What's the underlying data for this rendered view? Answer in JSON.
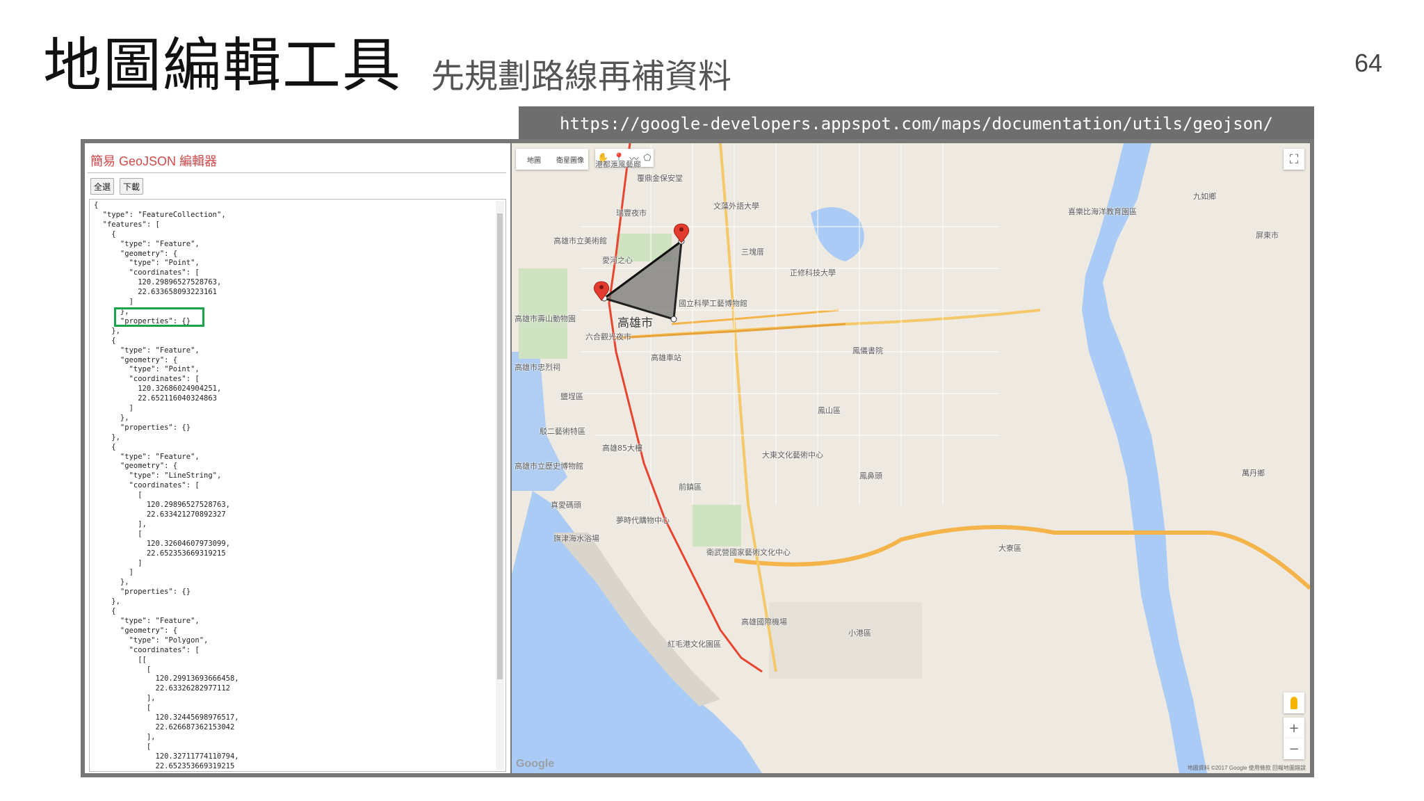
{
  "slide": {
    "title": "地圖編輯工具",
    "subtitle": "先規劃路線再補資料",
    "page_number": "64",
    "url": "https://google-developers.appspot.com/maps/documentation/utils/geojson/"
  },
  "editor": {
    "title": "簡易 GeoJSON 編輯器",
    "buttons": [
      "全選",
      "下載"
    ],
    "code": "{\n  \"type\": \"FeatureCollection\",\n  \"features\": [\n    {\n      \"type\": \"Feature\",\n      \"geometry\": {\n        \"type\": \"Point\",\n        \"coordinates\": [\n          120.29896527528763,\n          22.633658093223161\n        ]\n      },\n      \"properties\": {}\n    },\n    {\n      \"type\": \"Feature\",\n      \"geometry\": {\n        \"type\": \"Point\",\n        \"coordinates\": [\n          120.32686024904251,\n          22.652116040324863\n        ]\n      },\n      \"properties\": {}\n    },\n    {\n      \"type\": \"Feature\",\n      \"geometry\": {\n        \"type\": \"LineString\",\n        \"coordinates\": [\n          [\n            120.29896527528763,\n            22.633421270892327\n          ],\n          [\n            120.32604607973099,\n            22.652353669319215\n          ]\n        ]\n      },\n      \"properties\": {}\n    },\n    {\n      \"type\": \"Feature\",\n      \"geometry\": {\n        \"type\": \"Polygon\",\n        \"coordinates\": [\n          [[\n            [\n              120.29913693666458,\n              22.63326282977112\n            ],\n            [\n              120.32445698976517,\n              22.626687362153042\n            ],\n            [\n              120.32711774110794,\n              22.652353669319215\n            ],"
  },
  "map": {
    "type_buttons": [
      "地圖",
      "衛星圖像"
    ],
    "draw_tool_icons": [
      "hand-icon",
      "marker-icon",
      "line-icon",
      "polygon-icon"
    ],
    "fullscreen_icon": "⛶",
    "zoom_in": "+",
    "zoom_out": "−",
    "google_logo": "Google",
    "attribution": "地圖資料 ©2017 Google  使用條款  回報地圖錯誤",
    "colors": {
      "water": "#a9cbf5",
      "land": "#efeae1",
      "polygon_fill": "#6f6f6f",
      "metro_red": "#e8442f",
      "highway": "#f5b44a",
      "marker": "#e33b2e"
    },
    "city_label": "高雄市",
    "labels": [
      "港都滙風藝廊",
      "文藻外語大學",
      "瑞豐夜市",
      "高雄市立美術館",
      "愛河之心",
      "正修科技大學",
      "高雄巿壽山動物園",
      "國立科學工藝博物館",
      "六合觀光夜市",
      "高雄巿忠烈祠",
      "鹽埕區",
      "高雄車站",
      "鳳儀書院",
      "鳳山區",
      "高雄85大樓",
      "駁二藝術特區",
      "高雄巿立歷史博物館",
      "大東文化藝術中心",
      "夢時代購物中心",
      "前鎮區",
      "真愛碼頭",
      "鳳鼻頭",
      "高雄國際機場",
      "大寮區",
      "小港區",
      "紅毛港文化園區",
      "屏東市",
      "萬丹鄉",
      "九如鄉",
      "旗津海水浴場",
      "衛武營國家藝術文化中心",
      "覆鼎金保安堂",
      "喜樂比海洋教育園區",
      "三塊厝"
    ]
  }
}
